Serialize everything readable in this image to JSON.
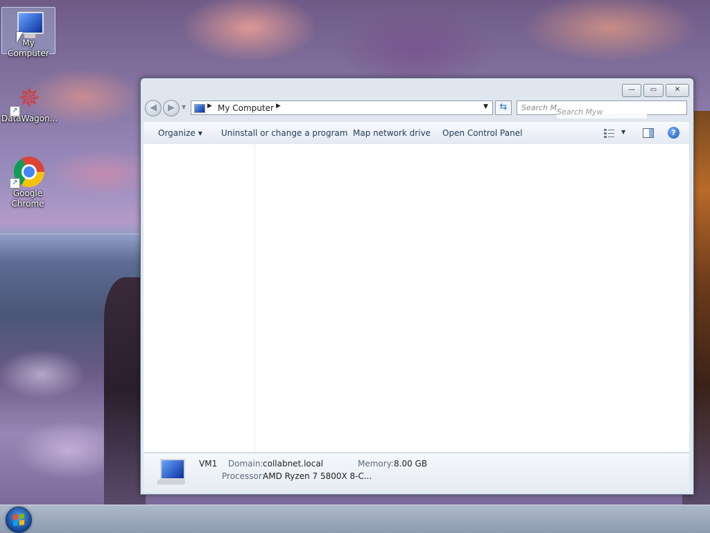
{
  "desktop": {
    "icons": [
      {
        "label": "My Computer",
        "icon": "computer-icon"
      },
      {
        "label": "DataWagon...",
        "icon": "datawagon-icon"
      },
      {
        "label": "Google Chrome",
        "icon": "chrome-icon"
      }
    ]
  },
  "window": {
    "controls": {
      "minimize": "—",
      "maximize": "▭",
      "close": "✕"
    },
    "address": {
      "crumb": "My Computer",
      "back": "◀",
      "forward": "▶"
    },
    "search": {
      "placeholder": "Search My...",
      "ghost": "Search Myw"
    },
    "toolbar": {
      "organize": "Organize",
      "uninstall": "Uninstall or change a program",
      "map_drive": "Map network drive",
      "control_panel": "Open Control Panel",
      "help": "?"
    },
    "details": {
      "name": "VM1",
      "domain_label": "Domain:",
      "domain_value": "collabnet.local",
      "memory_label": "Memory:",
      "memory_value": "8.00 GB",
      "processor_label": "Processor:",
      "processor_value": "AMD Ryzen 7 5800X 8-C..."
    }
  },
  "taskbar": {
    "start": "start-orb-icon"
  }
}
